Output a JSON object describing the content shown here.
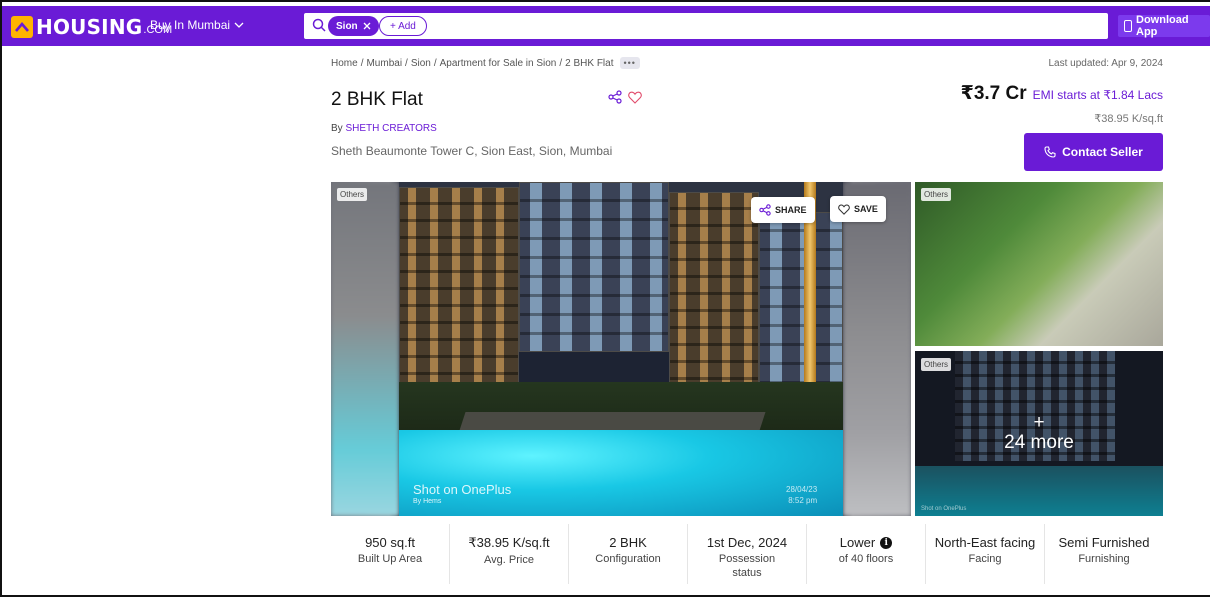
{
  "header": {
    "logo_text": "HOUSING",
    "logo_suffix": ".COM",
    "city_selector": "Buy In Mumbai",
    "search_chip": "Sion",
    "add_chip": "+ Add",
    "download_label": "Download App"
  },
  "breadcrumb": {
    "items": [
      "Home",
      "Mumbai",
      "Sion",
      "Apartment for Sale in Sion",
      "2 BHK Flat"
    ],
    "more": "•••"
  },
  "last_updated": "Last updated: Apr 9, 2024",
  "listing": {
    "title": "2 BHK Flat",
    "by_prefix": "By",
    "developer": "SHETH CREATORS",
    "address": "Sheth Beaumonte Tower C, Sion East, Sion, Mumbai",
    "price": "₹3.7 Cr",
    "emi": "EMI starts at ₹1.84 Lacs",
    "price_per_sqft": "₹38.95 K/sq.ft",
    "contact_label": "Contact Seller"
  },
  "gallery": {
    "main_tag": "Others",
    "share_label": "SHARE",
    "save_label": "SAVE",
    "caption_line1": "Shot on OnePlus",
    "caption_line2": "By Hems",
    "photo_date": "28/04/23",
    "photo_time": "8:52 pm",
    "side_top_tag": "Others",
    "side_bottom_tag": "Others",
    "more_plus": "+",
    "more_count": "24 more",
    "side_caption": "Shot on OnePlus"
  },
  "features": [
    {
      "value": "950 sq.ft",
      "label": "Built Up Area"
    },
    {
      "value": "₹38.95 K/sq.ft",
      "label": "Avg. Price"
    },
    {
      "value": "2 BHK",
      "label": "Configuration"
    },
    {
      "value": "1st Dec, 2024",
      "label": "Possession status"
    },
    {
      "value": "Lower",
      "label": "of 40 floors"
    },
    {
      "value": "North-East facing",
      "label": "Facing"
    },
    {
      "value": "Semi Furnished",
      "label": "Furnishing"
    }
  ],
  "colors": {
    "brand": "#6a1bd6",
    "logo_accent": "#ffb400"
  },
  "icons": [
    "search-icon",
    "close-icon",
    "chevron-down-icon",
    "share-icon",
    "heart-icon",
    "phone-icon",
    "info-icon"
  ]
}
